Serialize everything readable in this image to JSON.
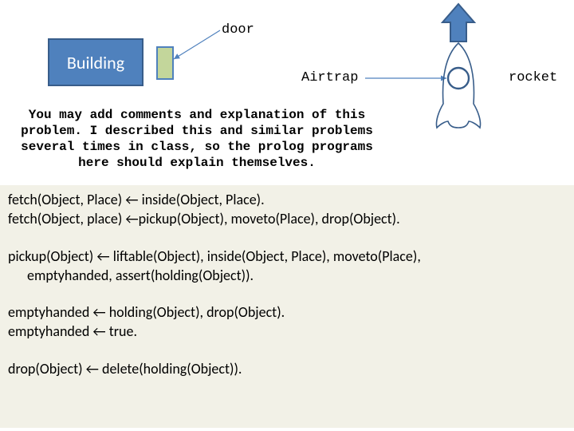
{
  "diagram": {
    "building_label": "Building",
    "door_label": "door",
    "airtrap_label": "Airtrap",
    "rocket_label": "rocket"
  },
  "comment": "You may add comments and explanation of this problem. I described this and similar problems several times in class, so the prolog programs here should explain themselves.",
  "prolog": {
    "l1": "fetch(Object, Place) ← inside(Object, Place).",
    "l2": "fetch(Object, place) ←pickup(Object), moveto(Place), drop(Object).",
    "l3a": "pickup(Object) ← liftable(Object), inside(Object, Place),  moveto(Place),",
    "l3b": "emptyhanded, assert(holding(Object)).",
    "l4": "emptyhanded ← holding(Object), drop(Object).",
    "l5": "emptyhanded ← true.",
    "l6": "drop(Object) ← delete(holding(Object))."
  }
}
